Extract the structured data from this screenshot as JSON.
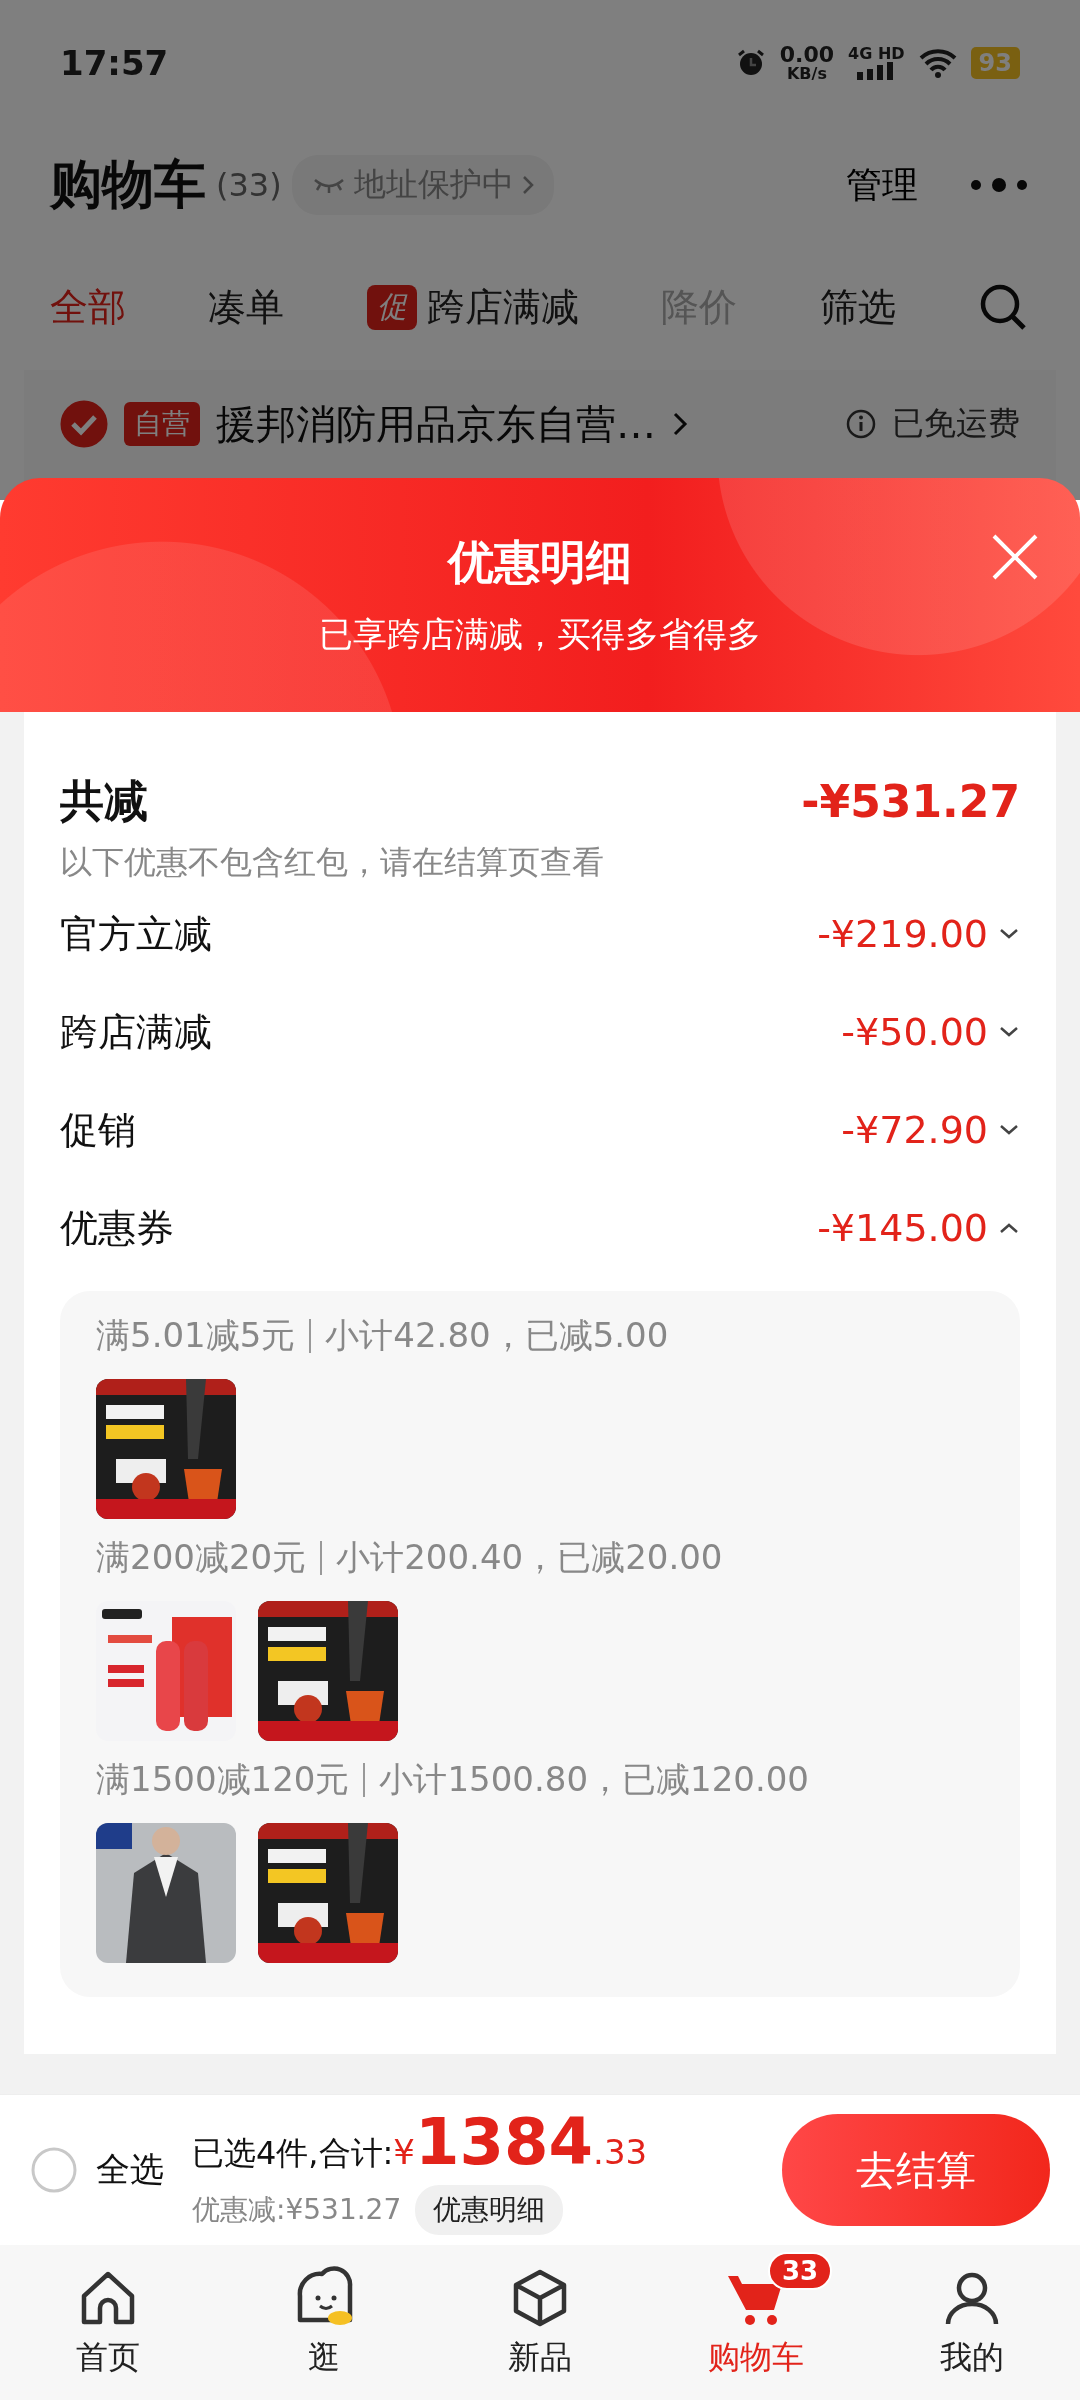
{
  "status_bar": {
    "time": "17:57",
    "net_speed": "0.00",
    "net_unit": "KB/s",
    "network": "4G HD",
    "battery": "93"
  },
  "header": {
    "title": "购物车",
    "count": "(33)",
    "address_chip": "地址保护中",
    "manage": "管理"
  },
  "tabs": [
    {
      "label": "全部",
      "selected": true,
      "disabled": false
    },
    {
      "label": "凑单",
      "selected": false,
      "disabled": false
    },
    {
      "label": "跨店满减",
      "selected": false,
      "disabled": false,
      "badge": "促"
    },
    {
      "label": "降价",
      "selected": false,
      "disabled": true
    },
    {
      "label": "筛选",
      "selected": false,
      "disabled": false
    }
  ],
  "store": {
    "checked": true,
    "tag": "自营",
    "name": "援邦消防用品京东自营…",
    "shipping": "已免运费"
  },
  "sheet": {
    "title": "优惠明细",
    "subtitle": "已享跨店满减，买得多省得多",
    "reduction_label": "共减",
    "reduction_value": "-¥531.27",
    "note": "以下优惠不包含红包，请在结算页查看",
    "discounts": [
      {
        "label": "官方立减",
        "amount": "-¥219.00",
        "expanded": false
      },
      {
        "label": "跨店满减",
        "amount": "-¥50.00",
        "expanded": false
      },
      {
        "label": "促销",
        "amount": "-¥72.90",
        "expanded": false
      },
      {
        "label": "优惠券",
        "amount": "-¥145.00",
        "expanded": true
      }
    ],
    "coupon_groups": [
      {
        "rule": "满5.01减5元",
        "detail": "小计42.80，已减5.00"
      },
      {
        "rule": "满200减20元",
        "detail": "小计200.40，已减20.00"
      },
      {
        "rule": "满1500减120元",
        "detail": "小计1500.80，已减120.00"
      }
    ]
  },
  "checkout": {
    "select_all": "全选",
    "checked": false,
    "summary": "已选4件,合计:",
    "currency": "¥",
    "amount_int": "1384",
    "amount_dec": ".33",
    "saving": "优惠减:¥531.27",
    "detail_chip": "优惠明细",
    "button": "去结算"
  },
  "nav": [
    {
      "label": "首页",
      "selected": false
    },
    {
      "label": "逛",
      "selected": false
    },
    {
      "label": "新品",
      "selected": false
    },
    {
      "label": "购物车",
      "selected": true,
      "badge": "33"
    },
    {
      "label": "我的",
      "selected": false
    }
  ]
}
